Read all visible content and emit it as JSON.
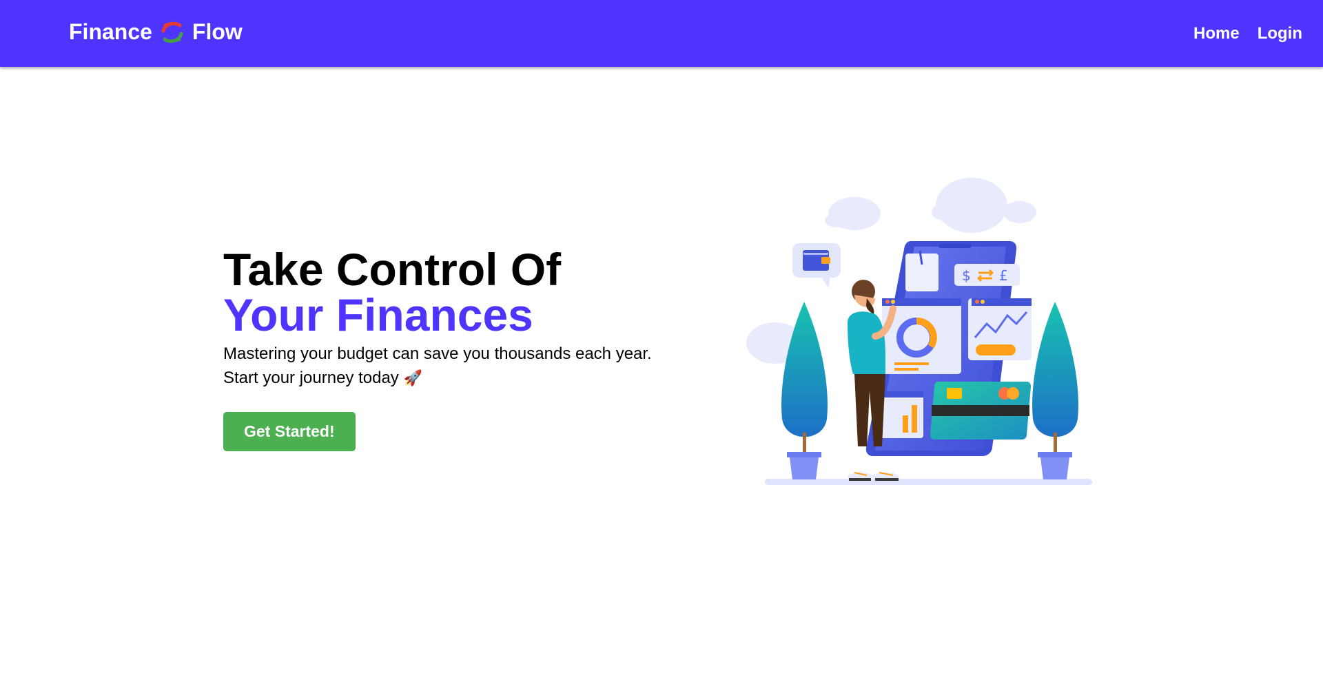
{
  "navbar": {
    "brand_left": "Finance",
    "brand_right": "Flow",
    "brand_icon": "exchange-arrows-icon",
    "links": [
      {
        "label": "Home"
      },
      {
        "label": "Login"
      }
    ],
    "background": "#4f34fd"
  },
  "hero": {
    "title_line1": "Take Control Of",
    "title_line2": "Your Finances",
    "subtitle_line1": "Mastering your budget can save you thousands each year.",
    "subtitle_line2": "Start your journey today",
    "subtitle_emoji": "🚀",
    "cta_label": "Get Started!",
    "cta_color": "#4caf50",
    "accent_color": "#4f34fd",
    "illustration": "finance-illustration",
    "card_symbols": [
      "$",
      "£"
    ]
  }
}
